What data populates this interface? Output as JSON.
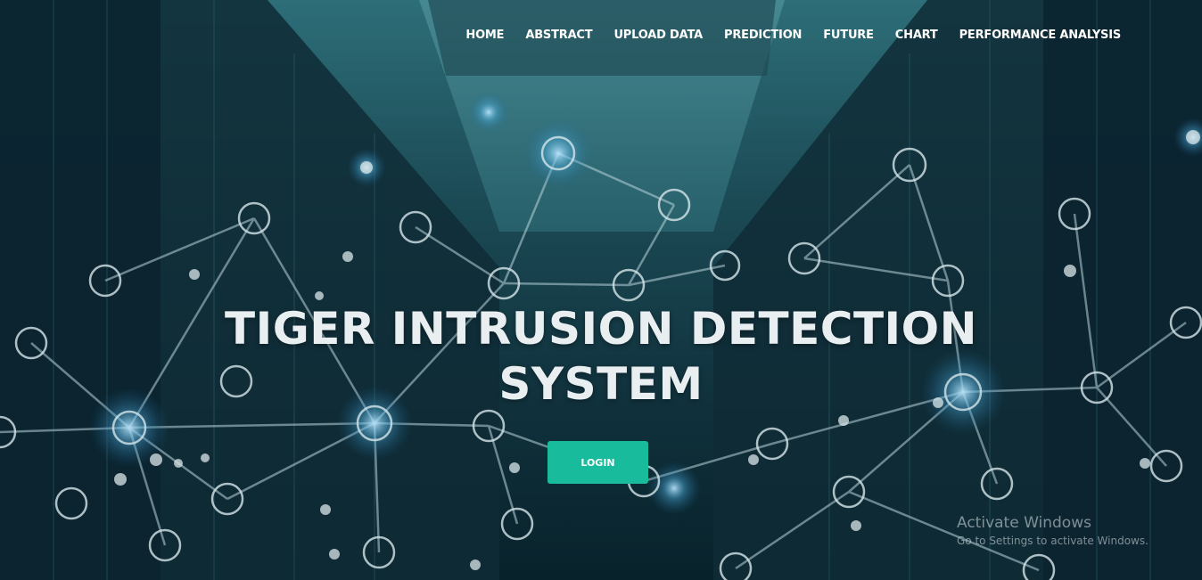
{
  "nav": {
    "items": [
      {
        "label": "HOME"
      },
      {
        "label": "ABSTRACT"
      },
      {
        "label": "UPLOAD DATA"
      },
      {
        "label": "PREDICTION"
      },
      {
        "label": "FUTURE"
      },
      {
        "label": "CHART"
      },
      {
        "label": "PERFORMANCE ANALYSIS"
      }
    ]
  },
  "hero": {
    "title_line1": "TIGER INTRUSION DETECTION",
    "title_line2": "SYSTEM",
    "login_label": "LOGIN"
  },
  "watermark": {
    "title": "Activate Windows",
    "subtitle": "Go to Settings to activate Windows."
  },
  "colors": {
    "accent": "#18bc9c",
    "background": "#1b4a55",
    "text": "#ffffff"
  }
}
